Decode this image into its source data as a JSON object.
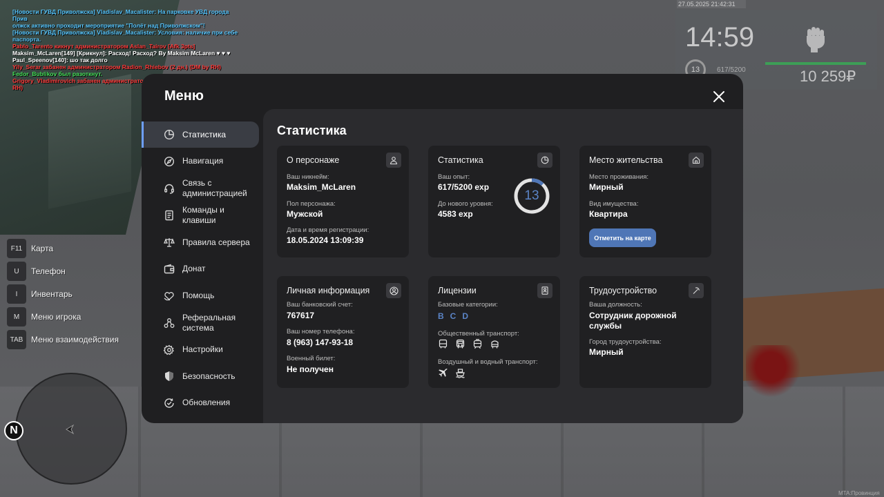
{
  "chat": [
    {
      "text": "[Новости ГУВД Приволжска] Vladislav_Macalister: На парковке УВД города Прив",
      "color": "#58c7ff"
    },
    {
      "text": "олжск активно проходит мероприятие \"Полёт над Приволжском\"!",
      "color": "#58c7ff"
    },
    {
      "text": "[Новости ГУВД Приволжска] Vladislav_Macalister: Условия: наличие при себе",
      "color": "#58c7ff"
    },
    {
      "text": "паспорта.",
      "color": "#58c7ff"
    },
    {
      "text": "Pablo_Tarento кикнут администратором Aslan_Tairov [Afk 3pts]",
      "color": "#ff3b3b"
    },
    {
      "text": "Maksim_McLaren[149] [Крикнул]: Расход! Расход? By Maksim McLaren ♥ ♥ ♥",
      "color": "#ffffff"
    },
    {
      "text": "Paul_Speenov[140]: шо так долго",
      "color": "#ffffff"
    },
    {
      "text": "Yily_Serar забанен администратором Radion_Rhiebov (2 дн.) (DM by RH)",
      "color": "#ff3b3b"
    },
    {
      "text": "Fedor_Bublikov был разоткнут.",
      "color": "#46e05a"
    },
    {
      "text": "Grigory_Vladimirovich забанен администратором Radion_Rhiebov. (Cheat by RH)",
      "color": "#ff3b3b"
    }
  ],
  "hud": {
    "date": "27.05.2025 21:42:31",
    "time": "14:59",
    "level": "13",
    "exp": "617/5200",
    "money": "10 259₽",
    "icon": "fist-icon"
  },
  "hotkeys": [
    {
      "key": "F11",
      "label": "Карта"
    },
    {
      "key": "U",
      "label": "Телефон"
    },
    {
      "key": "I",
      "label": "Инвентарь"
    },
    {
      "key": "M",
      "label": "Меню игрока"
    },
    {
      "key": "TAB",
      "label": "Меню взаимодействия"
    }
  ],
  "radar": {
    "north": "N"
  },
  "watermark": "MTA:Провинция",
  "menu": {
    "title": "Меню",
    "sidebar": [
      {
        "label": "Статистика",
        "icon": "pie-chart-icon",
        "active": true
      },
      {
        "label": "Навигация",
        "icon": "compass-icon"
      },
      {
        "label": "Связь с администрацией",
        "icon": "headset-icon"
      },
      {
        "label": "Команды и клавиши",
        "icon": "document-icon"
      },
      {
        "label": "Правила сервера",
        "icon": "scales-icon"
      },
      {
        "label": "Донат",
        "icon": "wallet-icon"
      },
      {
        "label": "Помощь",
        "icon": "heart-hand-icon"
      },
      {
        "label": "Реферальная система",
        "icon": "network-icon"
      },
      {
        "label": "Настройки",
        "icon": "gear-icon"
      },
      {
        "label": "Безопасность",
        "icon": "shield-icon"
      },
      {
        "label": "Обновления",
        "icon": "refresh-check-icon"
      }
    ],
    "content_title": "Статистика",
    "character": {
      "title": "О персонаже",
      "nickname_label": "Ваш никнейм:",
      "nickname": "Maksim_McLaren",
      "gender_label": "Пол персонажа:",
      "gender": "Мужской",
      "reg_label": "Дата и время регистрации:",
      "reg": "18.05.2024 13:09:39"
    },
    "stats": {
      "title": "Статистика",
      "exp_label": "Ваш опыт:",
      "exp": "617/5200 exp",
      "next_label": "До нового уровня:",
      "next": "4583 exp",
      "level": "13",
      "progress": 0.1187
    },
    "residence": {
      "title": "Место жительства",
      "place_label": "Место проживания:",
      "place": "Мирный",
      "property_label": "Вид имущества:",
      "property": "Квартира",
      "button": "Отметить на карте"
    },
    "personal": {
      "title": "Личная информация",
      "bank_label": "Ваш банковский счет:",
      "bank": "767617",
      "phone_label": "Ваш номер телефона:",
      "phone": "8 (963) 147-93-18",
      "military_label": "Военный билет:",
      "military": "Не получен"
    },
    "licenses": {
      "title": "Лицензии",
      "base_label": "Базовые категории:",
      "categories": [
        "B",
        "C",
        "D"
      ],
      "public_label": "Общественный транспорт:",
      "air_label": "Воздушный и водный транспорт:"
    },
    "job": {
      "title": "Трудоустройство",
      "position_label": "Ваша должность:",
      "position": "Сотрудник дорожной службы",
      "city_label": "Город трудоустройства:",
      "city": "Мирный"
    }
  }
}
